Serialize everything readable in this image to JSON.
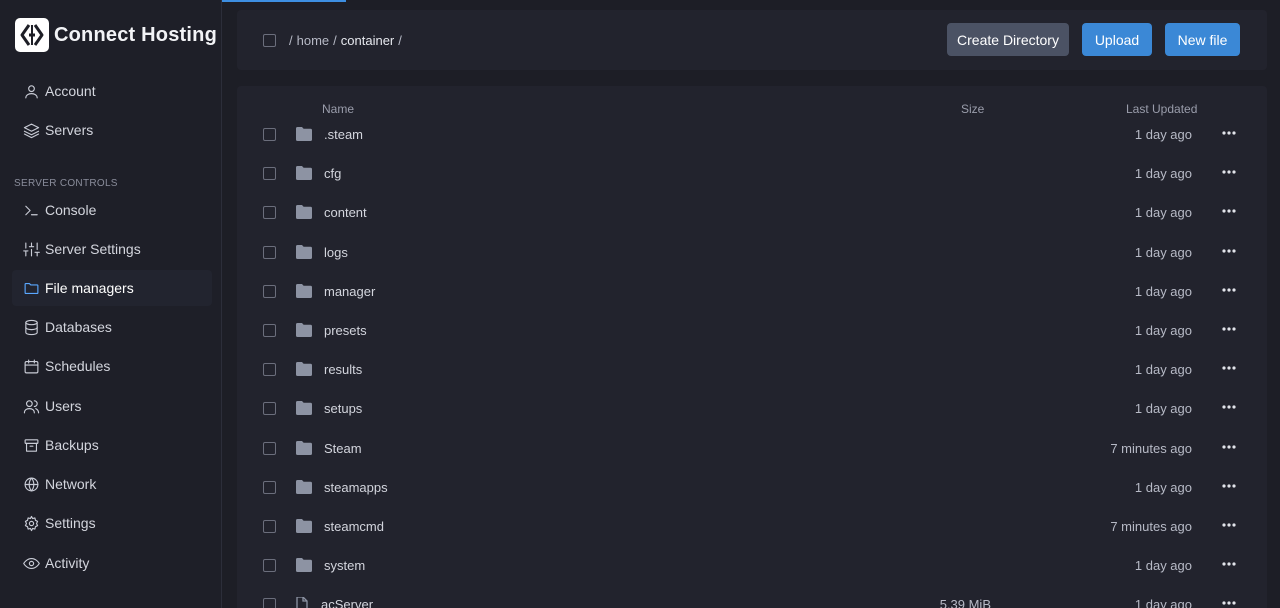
{
  "brand": {
    "name": "Connect Hosting",
    "logo_icon": "connect-hosting-logo"
  },
  "sidebar": {
    "items": [
      {
        "label": "Account",
        "icon": "user-icon"
      },
      {
        "label": "Servers",
        "icon": "layers-icon"
      }
    ],
    "section_label": "SERVER CONTROLS",
    "controls": [
      {
        "label": "Console",
        "icon": "terminal-icon"
      },
      {
        "label": "Server Settings",
        "icon": "sliders-icon"
      },
      {
        "label": "File managers",
        "icon": "folder-icon",
        "active": true
      },
      {
        "label": "Databases",
        "icon": "database-icon"
      },
      {
        "label": "Schedules",
        "icon": "calendar-icon"
      },
      {
        "label": "Users",
        "icon": "users-icon"
      },
      {
        "label": "Backups",
        "icon": "archive-icon"
      },
      {
        "label": "Network",
        "icon": "globe-icon"
      },
      {
        "label": "Settings",
        "icon": "gear-icon"
      },
      {
        "label": "Activity",
        "icon": "eye-icon"
      }
    ]
  },
  "header": {
    "breadcrumb": {
      "root": "/",
      "home": "home",
      "sep": "/",
      "current": "container",
      "trail": "/"
    },
    "create_directory_label": "Create Directory",
    "upload_label": "Upload",
    "new_file_label": "New file"
  },
  "table": {
    "columns": {
      "name": "Name",
      "size": "Size",
      "updated": "Last Updated"
    },
    "rows": [
      {
        "name": ".steam",
        "type": "folder",
        "size": "",
        "updated": "1 day ago"
      },
      {
        "name": "cfg",
        "type": "folder",
        "size": "",
        "updated": "1 day ago"
      },
      {
        "name": "content",
        "type": "folder",
        "size": "",
        "updated": "1 day ago"
      },
      {
        "name": "logs",
        "type": "folder",
        "size": "",
        "updated": "1 day ago"
      },
      {
        "name": "manager",
        "type": "folder",
        "size": "",
        "updated": "1 day ago"
      },
      {
        "name": "presets",
        "type": "folder",
        "size": "",
        "updated": "1 day ago"
      },
      {
        "name": "results",
        "type": "folder",
        "size": "",
        "updated": "1 day ago"
      },
      {
        "name": "setups",
        "type": "folder",
        "size": "",
        "updated": "1 day ago"
      },
      {
        "name": "Steam",
        "type": "folder",
        "size": "",
        "updated": "7 minutes ago"
      },
      {
        "name": "steamapps",
        "type": "folder",
        "size": "",
        "updated": "1 day ago"
      },
      {
        "name": "steamcmd",
        "type": "folder",
        "size": "",
        "updated": "7 minutes ago"
      },
      {
        "name": "system",
        "type": "folder",
        "size": "",
        "updated": "1 day ago"
      },
      {
        "name": "acServer",
        "type": "file",
        "size": "5.39 MiB",
        "updated": "1 day ago"
      }
    ]
  },
  "colors": {
    "accent": "#3b88d6",
    "background": "#1d1e26",
    "card": "#22232d"
  }
}
